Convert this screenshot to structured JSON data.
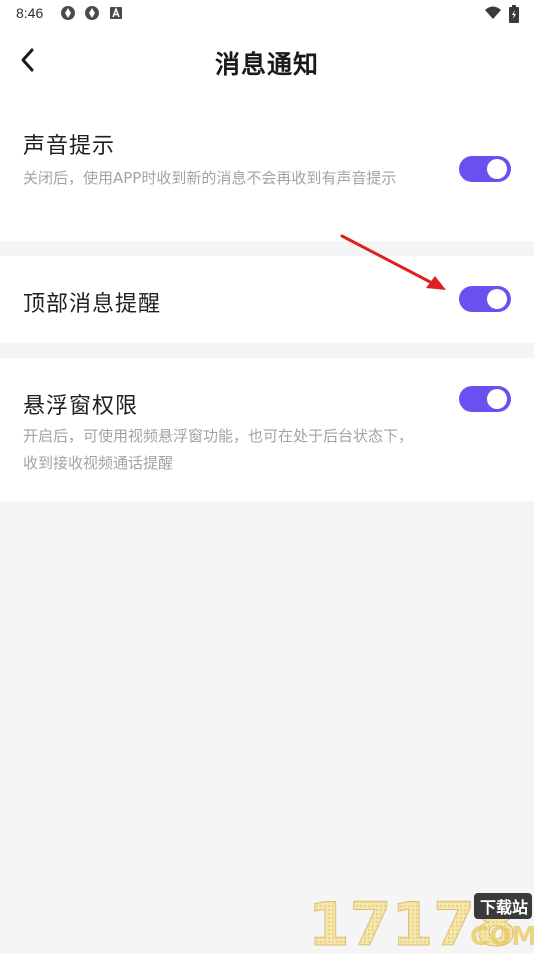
{
  "status_bar": {
    "time": "8:46",
    "icons": [
      "sync-icon",
      "sync-icon",
      "a-box-icon",
      "wifi-icon",
      "battery-icon"
    ]
  },
  "header": {
    "title": "消息通知"
  },
  "settings": [
    {
      "title": "声音提示",
      "description": "关闭后，使用APP时收到新的消息不会再收到有声音提示",
      "enabled": true
    },
    {
      "title": "顶部消息提醒",
      "description": "",
      "enabled": true
    },
    {
      "title": "悬浮窗权限",
      "description": "开启后，可使用视频悬浮窗功能，也可在处于后台状态下，收到接收视频通话提醒",
      "enabled": true
    }
  ],
  "colors": {
    "toggle_on": "#6c4ff0",
    "annotation_arrow": "#e02020",
    "page_background": "#f5f5f5"
  },
  "watermark": {
    "text": "17178",
    "badge": "下载站",
    "suffix": "COM"
  }
}
